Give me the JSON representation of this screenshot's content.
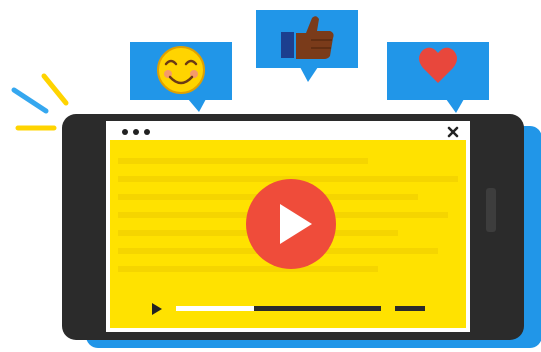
{
  "illustration": {
    "subject": "smartphone-video-player-with-reactions",
    "orientation": "landscape",
    "reactions": [
      {
        "name": "smiley-face-icon",
        "color": "#ffd400"
      },
      {
        "name": "thumbs-up-icon",
        "color": "#7a3b1a"
      },
      {
        "name": "heart-icon",
        "color": "#e8473c"
      }
    ],
    "colors": {
      "bubble_blue": "#2196e8",
      "phone_body": "#2b2b2b",
      "screen_yellow": "#ffe200",
      "screen_yellow_dark": "#f4c400",
      "play_button_red": "#ef4c3a",
      "accent_lines": "#ffd400",
      "accent_blue": "#35a7ef"
    },
    "player": {
      "window_dots": 3,
      "close_glyph": "×",
      "progress_fraction": 0.38
    }
  }
}
